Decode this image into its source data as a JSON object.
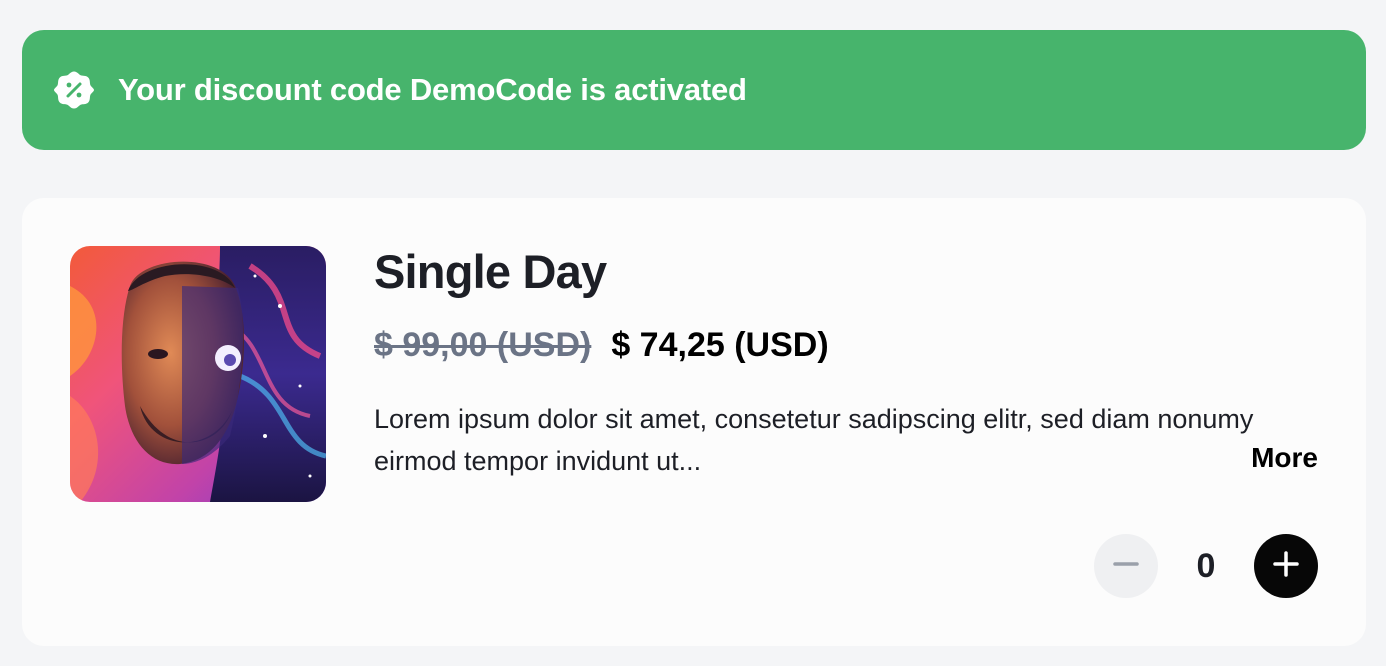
{
  "banner": {
    "icon": "discount-badge-icon",
    "message": "Your discount code DemoCode is activated",
    "background_color": "#47b46c"
  },
  "product": {
    "image_alt": "album-art-portrait",
    "title": "Single Day",
    "original_price": "$ 99,00 (USD)",
    "discounted_price": "$ 74,25 (USD)",
    "description": "Lorem ipsum dolor sit amet, consetetur sadipscing elitr, sed diam nonumy eirmod tempor invidunt ut...",
    "more_label": "More",
    "quantity": "0",
    "minus_icon": "minus-icon",
    "plus_icon": "plus-icon"
  }
}
